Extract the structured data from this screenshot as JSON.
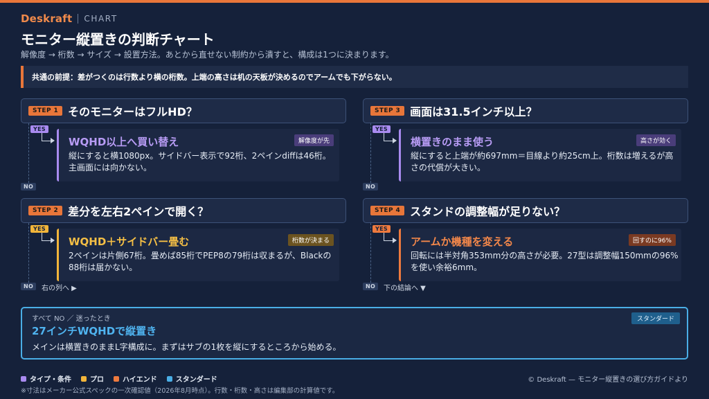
{
  "brand": {
    "name": "Deskraft",
    "section": "CHART"
  },
  "title": "モニター縦置きの判断チャート",
  "subtitle": "解像度 → 桁数 → サイズ → 設置方法。あとから直せない制約から潰すと、構成は1つに決まります。",
  "premise": "共通の前提：差がつくのは行数より横の桁数。上端の高さは机の天板が決めるのでアームでも下がらない。",
  "labels": {
    "yes": "YES",
    "no": "NO"
  },
  "steps": [
    {
      "badge": "STEP 1",
      "question": "そのモニターはフルHD？",
      "result": {
        "title": "WQHD以上へ買い替え",
        "tag": "解像度が先",
        "desc": "縦にすると横1080px。サイドバー表示で92桁、2ペインdiffは46桁。主画面には向かない。",
        "category": "タイプ・条件"
      },
      "no_note": ""
    },
    {
      "badge": "STEP 2",
      "question": "差分を左右2ペインで開く？",
      "result": {
        "title": "WQHD＋サイドバー畳む",
        "tag": "桁数が決まる",
        "desc": "2ペインは片側67桁。畳めば85桁でPEP8の79桁は収まるが、Blackの88桁は届かない。",
        "category": "プロ"
      },
      "no_note": "右の列へ ▶"
    },
    {
      "badge": "STEP 3",
      "question": "画面は31.5インチ以上？",
      "result": {
        "title": "横置きのまま使う",
        "tag": "高さが効く",
        "desc": "縦にすると上端が約697mm＝目線より約25cm上。桁数は増えるが高さの代償が大きい。",
        "category": "タイプ・条件"
      },
      "no_note": ""
    },
    {
      "badge": "STEP 4",
      "question": "スタンドの調整幅が足りない？",
      "result": {
        "title": "アームか機種を変える",
        "tag": "回すのに96%",
        "desc": "回転には半対角353mm分の高さが必要。27型は調整幅150mmの96%を使い余裕6mm。",
        "category": "ハイエンド"
      },
      "no_note": "下の結論へ ▼"
    }
  ],
  "standard": {
    "label": "すべて NO ／ 迷ったとき",
    "title": "27インチWQHDで縦置き",
    "desc": "メインは横置きのままL字構成に。まずはサブの1枚を縦にするところから始める。",
    "tag": "スタンダード"
  },
  "legend": [
    {
      "label": "タイプ・条件",
      "color": "#a98bf0"
    },
    {
      "label": "プロ",
      "color": "#f2b53a"
    },
    {
      "label": "ハイエンド",
      "color": "#ee7a3e"
    },
    {
      "label": "スタンダード",
      "color": "#4aaee6"
    }
  ],
  "credit": "© Deskraft — モニター縦置きの選び方ガイドより",
  "footnote": "※寸法はメーカー公式スペックの一次確認値（2026年8月時点）。行数・桁数・高さは編集部の計算値です。",
  "colors": {
    "accent": "#e8763a",
    "type": "#a98bf0",
    "pro": "#f2b53a",
    "high": "#ee7a3e",
    "standard": "#4aaee6"
  }
}
